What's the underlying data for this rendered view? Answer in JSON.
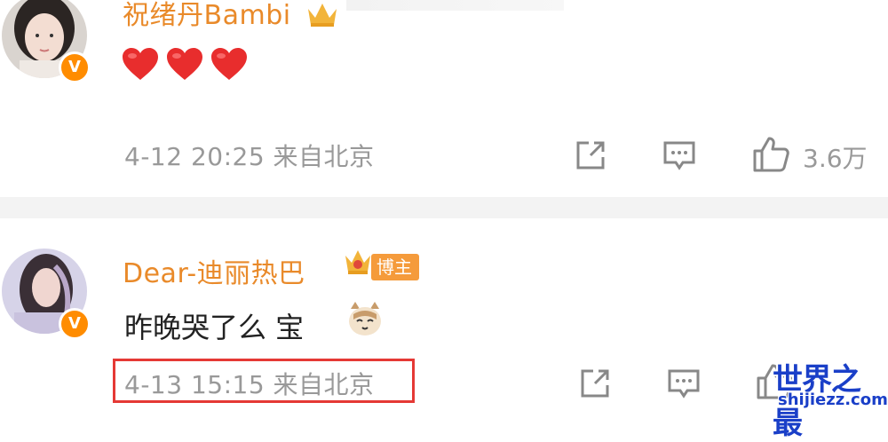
{
  "comments": [
    {
      "username": "祝绪丹Bambi",
      "verified_badge": "V",
      "content_emoji": [
        "heart",
        "heart",
        "heart"
      ],
      "meta": "4-12 20:25 来自北京",
      "like_count": "3.6万"
    },
    {
      "username": "Dear-迪丽热巴",
      "verified_badge": "V",
      "role_badge": "博主",
      "content": "昨晚哭了么 宝",
      "meta": "4-13 15:15 来自北京"
    }
  ],
  "watermark": {
    "title": "世界之最",
    "url": "shijiezz.com"
  },
  "colors": {
    "username": "#e98a2a",
    "badge": "#ff8c00",
    "meta": "#999999",
    "highlight": "#e53935",
    "watermark": "#1a3fc8"
  }
}
